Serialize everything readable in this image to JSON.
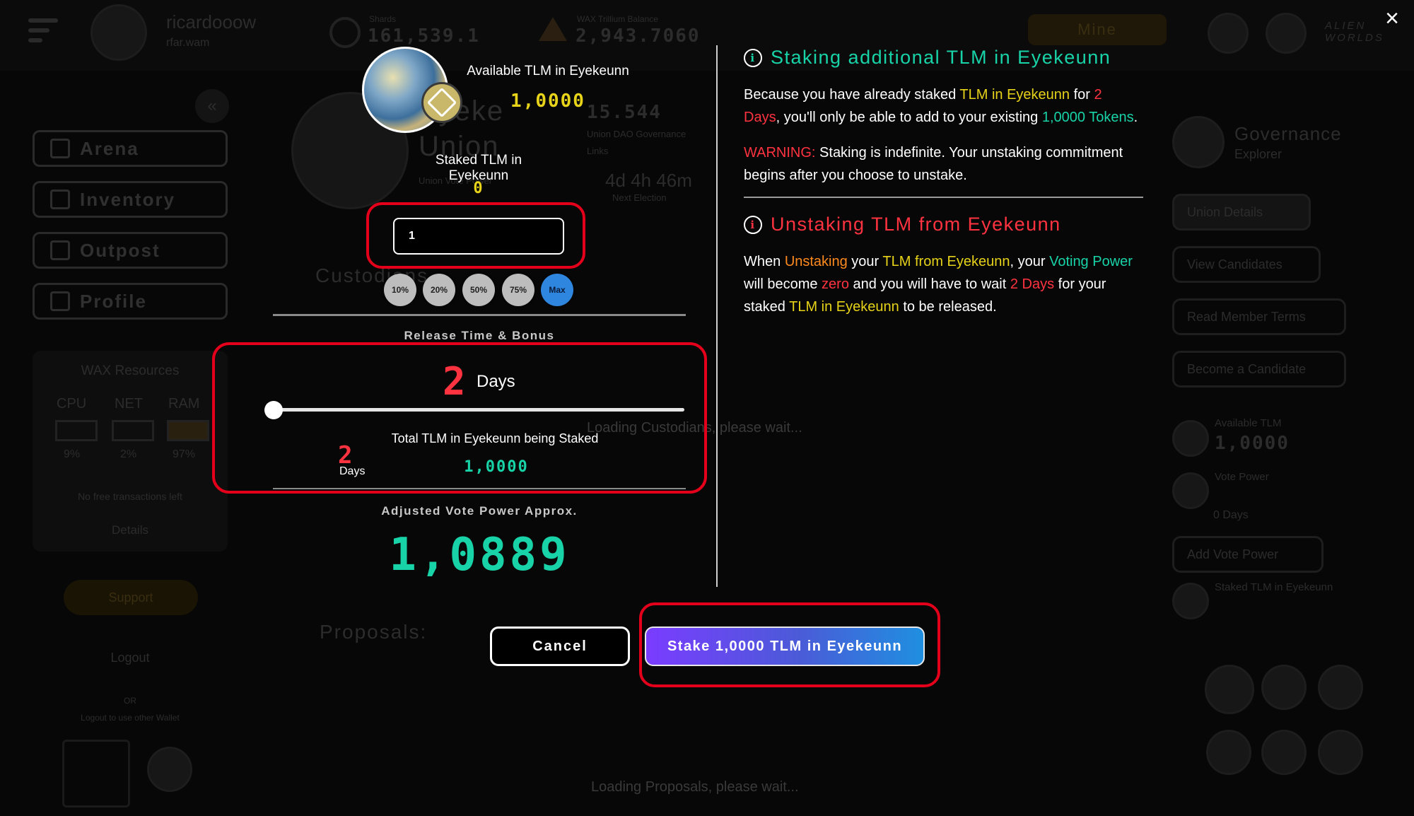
{
  "background": {
    "user": {
      "name": "ricardooow",
      "wallet": "rfar.wam"
    },
    "stats": [
      {
        "label": "Shards",
        "value": "161,539.1"
      },
      {
        "label": "WAX Trillium Balance",
        "value": "2,943.7060"
      }
    ],
    "mine_label": "Mine",
    "brand": "ALIEN WORLDS",
    "sidebar": [
      {
        "label": "Arena"
      },
      {
        "label": "Inventory"
      },
      {
        "label": "Outpost"
      },
      {
        "label": "Profile"
      }
    ],
    "wax_resources": {
      "title": "WAX Resources",
      "cols": [
        "CPU",
        "NET",
        "RAM"
      ],
      "pcts": [
        "9%",
        "2%",
        "97%"
      ],
      "note": "No free transactions left",
      "details": "Details"
    },
    "support": "Support",
    "logout": "Logout",
    "or": "OR",
    "logout_other": "Logout to use other Wallet",
    "planet": {
      "name": "Eyeke Union",
      "union_vote": "Union Vote Power"
    },
    "stats_mid": [
      {
        "value": "15.544",
        "label": "Union DAO Governance Links"
      },
      {
        "value": "4d 4h 46m",
        "label": "Next Election"
      }
    ],
    "custodians_title": "Custodians",
    "loading_custodians": "Loading Custodians, please wait...",
    "proposals_title": "Proposals:",
    "loading_proposals": "Loading Proposals, please wait...",
    "governance": {
      "title": "Governance",
      "subtitle": "Explorer"
    },
    "right_buttons": [
      {
        "label": "Union Details"
      },
      {
        "label": "View Candidates"
      },
      {
        "label": "Read Member Terms"
      },
      {
        "label": "Become a Candidate"
      }
    ],
    "right_stats": {
      "available_label": "Available TLM",
      "available_value": "1,0000",
      "vote_label": "Vote Power",
      "vote_days": "0 Days",
      "add_vote": "Add Vote Power",
      "staked_label": "Staked TLM in Eyekeunn"
    }
  },
  "modal": {
    "close_icon": "×",
    "available_label": "Available TLM in Eyekeunn",
    "available_value": "1,0000",
    "staked_label": "Staked TLM in Eyekeunn",
    "staked_value": "0",
    "amount_input": "1",
    "pct_buttons": [
      "10%",
      "20%",
      "50%",
      "75%",
      "Max"
    ],
    "release_title": "Release Time & Bonus",
    "days_value": "2",
    "days_label": "Days",
    "slider_fraction": 0.0,
    "total_label": "Total TLM in Eyekeunn being Staked",
    "small_days_value": "2",
    "small_days_label": "Days",
    "total_value": "1,0000",
    "vote_title": "Adjusted Vote Power Approx.",
    "vote_value": "1,0889",
    "cancel": "Cancel",
    "stake": "Stake 1,0000 TLM in Eyekeunn",
    "info1": {
      "title": "Staking additional TLM in Eyekeunn",
      "p1": [
        "Because you have already staked ",
        "TLM in Eyekeunn",
        " for ",
        "2 Days",
        ",",
        " you'll only be able to add to your existing ",
        "1,0000 Tokens",
        "."
      ],
      "p2": [
        "WARNING:",
        " Staking is indefinite. Your unstaking commitment begins after you choose to unstake."
      ]
    },
    "info2": {
      "title": "Unstaking TLM from Eyekeunn",
      "p": [
        "When ",
        "Unstaking",
        " your ",
        "TLM from Eyekeunn",
        ", your ",
        "Voting Power",
        " will become ",
        "zero",
        " and you will have to wait ",
        "2 Days",
        " for your staked ",
        "TLM in Eyekeunn",
        " to be released."
      ]
    },
    "colors": {
      "accent_teal": "#19d3a8",
      "gold": "#e6d31a",
      "warning_red": "#ff3340",
      "highlight_red": "#e4001a"
    }
  }
}
